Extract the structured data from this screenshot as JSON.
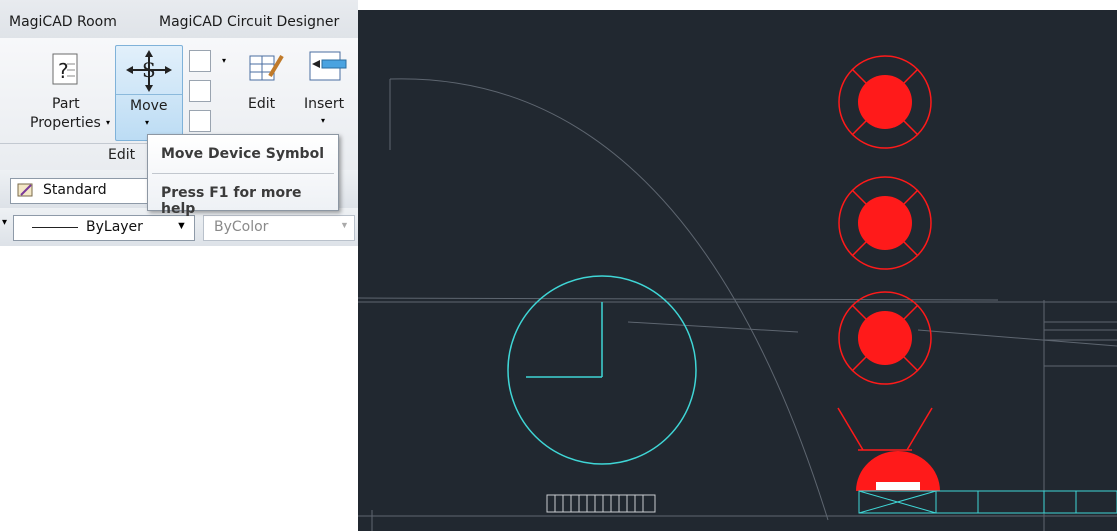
{
  "ribbon": {
    "tabs": [
      "MagiCAD Room",
      "MagiCAD Circuit Designer"
    ],
    "part_properties_label_1": "Part",
    "part_properties_label_2": "Properties",
    "move_label": "Move",
    "edit_label": "Edit",
    "insert_label": "Insert",
    "group_label": "Edit"
  },
  "style_toolbar": {
    "text_style": "Standard"
  },
  "layer_toolbar": {
    "linetype": "ByLayer",
    "plot_style": "ByColor"
  },
  "tooltip": {
    "title": "Move Device Symbol",
    "help": "Press F1 for more help"
  },
  "drawing": {
    "background": "#212830",
    "symbol_color": "#ff1a1a",
    "circle_color": "#3fd6d6",
    "line_color": "#6e7680"
  },
  "icons": [
    "part-properties-icon",
    "move-icon",
    "edit-icon",
    "insert-icon",
    "text-style-icon",
    "dropdown-arrow-icon"
  ]
}
